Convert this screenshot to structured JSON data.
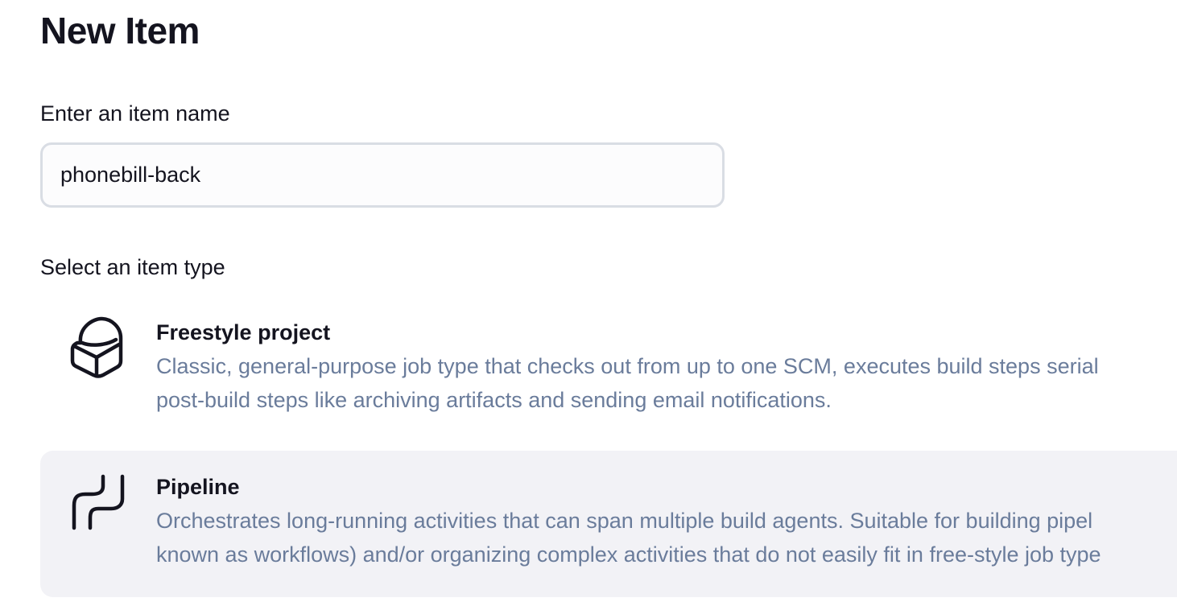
{
  "page": {
    "title": "New Item"
  },
  "name_field": {
    "label": "Enter an item name",
    "value": "phonebill-back"
  },
  "type_section": {
    "label": "Select an item type",
    "items": [
      {
        "name": "Freestyle project",
        "icon": "box-icon",
        "description_lines": [
          "Classic, general-purpose job type that checks out from up to one SCM, executes build steps serial",
          "post-build steps like archiving artifacts and sending email notifications."
        ],
        "selected": false
      },
      {
        "name": "Pipeline",
        "icon": "pipeline-icon",
        "description_lines": [
          "Orchestrates long-running activities that can span multiple build agents. Suitable for building pipel",
          "known as workflows) and/or organizing complex activities that do not easily fit in free-style job type"
        ],
        "selected": true
      }
    ]
  },
  "colors": {
    "text": "#14141f",
    "description": "#6a7c9b",
    "selected_background": "#f2f2f6",
    "input_border": "#d9dde4"
  }
}
